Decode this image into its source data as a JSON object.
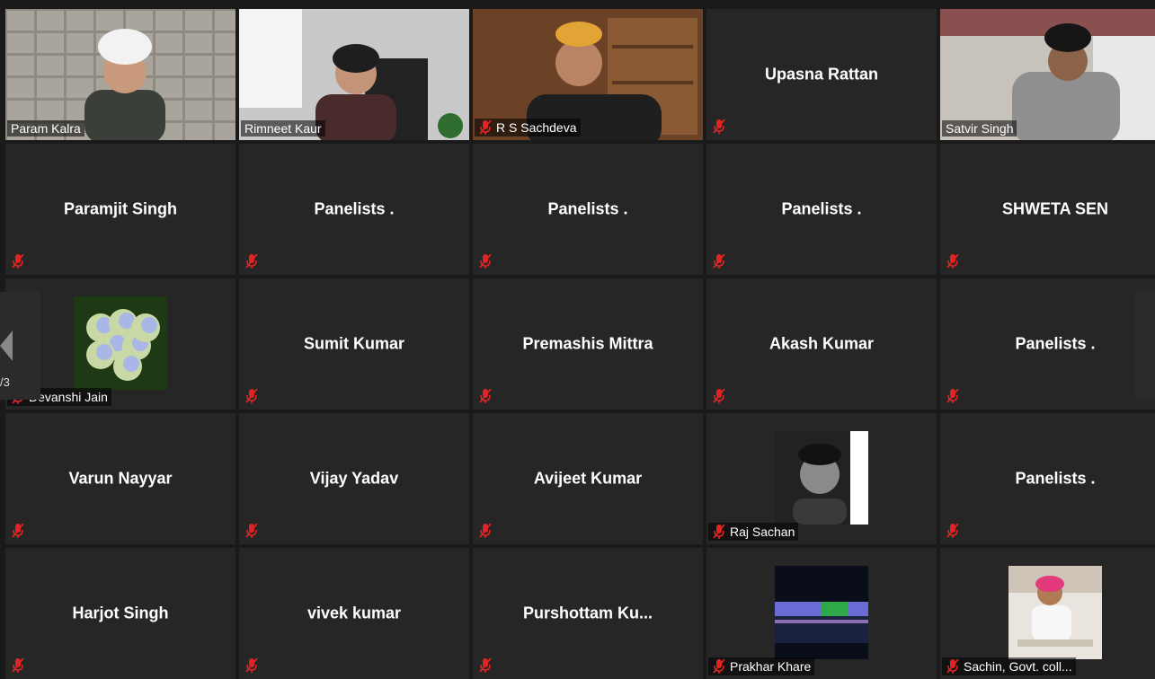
{
  "page_indicator": "/3",
  "participants": [
    {
      "name": "Param Kalra",
      "type": "video",
      "scene": "wall",
      "active": true
    },
    {
      "name": "Rimneet Kaur",
      "type": "video",
      "scene": "office"
    },
    {
      "name": "R S Sachdeva",
      "type": "video",
      "scene": "bookshelf",
      "muted": true
    },
    {
      "name": "Upasna Rattan",
      "type": "name",
      "muted": true
    },
    {
      "name": "Satvir Singh",
      "type": "video",
      "scene": "room"
    },
    {
      "name": "Paramjit Singh",
      "type": "name",
      "muted": true
    },
    {
      "name": "Panelists .",
      "type": "name",
      "muted": true
    },
    {
      "name": "Panelists .",
      "type": "name",
      "muted": true
    },
    {
      "name": "Panelists .",
      "type": "name",
      "muted": true
    },
    {
      "name": "SHWETA SEN",
      "type": "name",
      "muted": true
    },
    {
      "name": "Devanshi Jain",
      "type": "photo",
      "photo": "flowers",
      "muted": true
    },
    {
      "name": "Sumit Kumar",
      "type": "name",
      "muted": true
    },
    {
      "name": "Premashis Mittra",
      "type": "name",
      "muted": true
    },
    {
      "name": "Akash Kumar",
      "type": "name",
      "muted": true
    },
    {
      "name": "Panelists .",
      "type": "name",
      "muted": true
    },
    {
      "name": "Varun Nayyar",
      "type": "name",
      "muted": true
    },
    {
      "name": "Vijay Yadav",
      "type": "name",
      "muted": true
    },
    {
      "name": "Avijeet Kumar",
      "type": "name",
      "muted": true
    },
    {
      "name": "Raj Sachan",
      "type": "photo",
      "photo": "portrait-bw",
      "muted": true
    },
    {
      "name": "Panelists .",
      "type": "name",
      "muted": true
    },
    {
      "name": "Harjot Singh",
      "type": "name",
      "muted": true
    },
    {
      "name": "vivek kumar",
      "type": "name",
      "muted": true
    },
    {
      "name": "Purshottam  Ku...",
      "type": "name",
      "muted": true
    },
    {
      "name": "Prakhar Khare",
      "type": "photo",
      "photo": "night-bridge",
      "muted": true
    },
    {
      "name": "Sachin, Govt. coll...",
      "type": "photo",
      "photo": "portrait-color",
      "muted": true
    }
  ],
  "colors": {
    "active_border": "#b8e05a",
    "mute_red": "#e02424",
    "tile_bg": "#262626"
  },
  "icons": {
    "mute": "microphone-muted-icon",
    "prev": "chevron-left-icon"
  }
}
